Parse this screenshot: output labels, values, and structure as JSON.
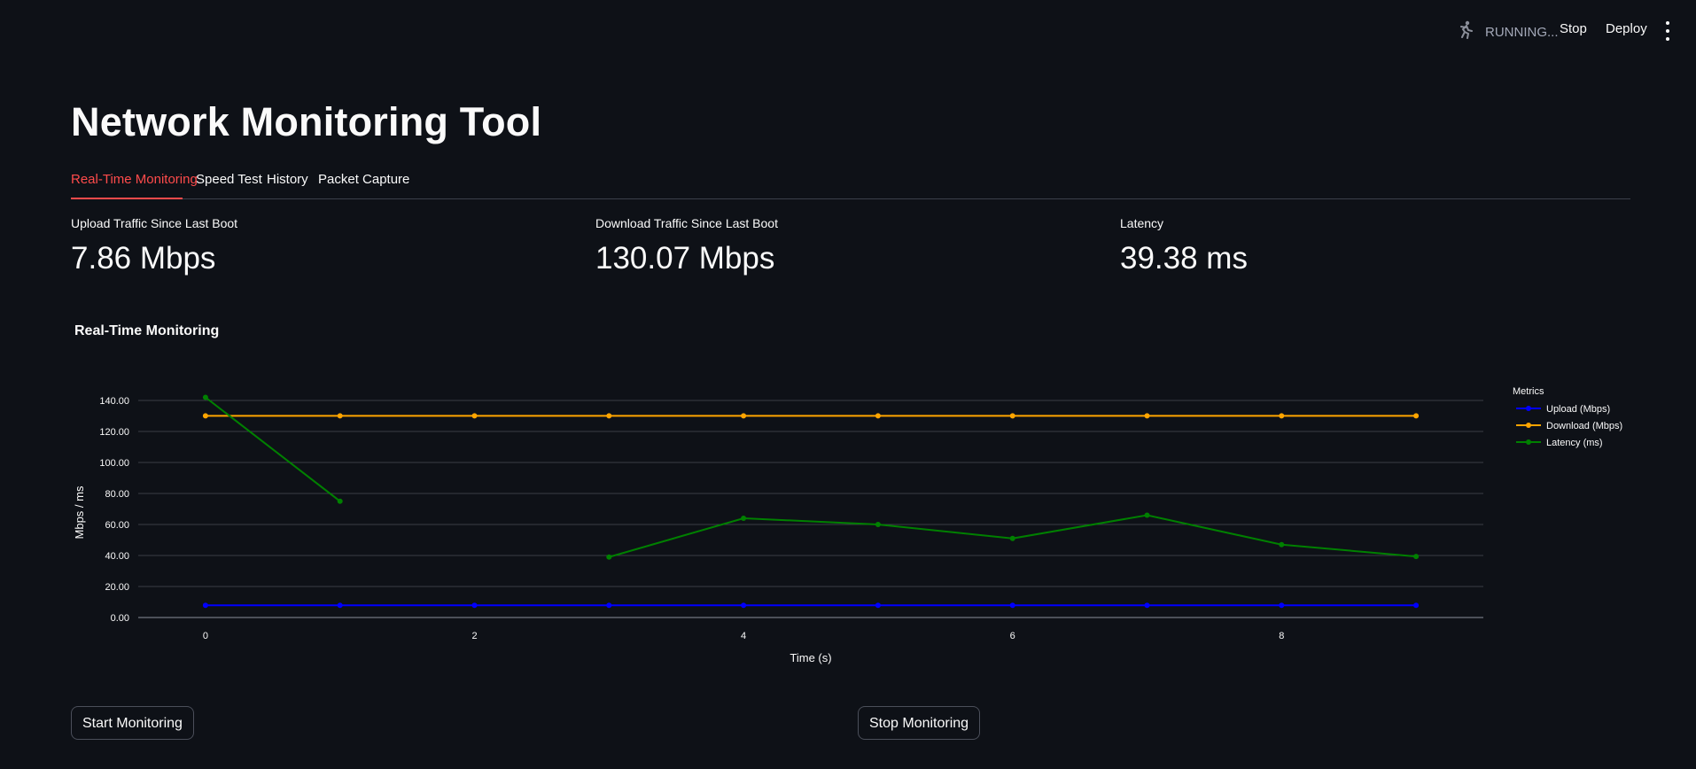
{
  "header": {
    "status_text": "RUNNING...",
    "stop_label": "Stop",
    "deploy_label": "Deploy",
    "menu_icon": "vertical-dots-icon",
    "status_icon": "running-figure-icon"
  },
  "page": {
    "title": "Network Monitoring Tool"
  },
  "tabs": [
    {
      "label": "Real-Time Monitoring",
      "active": true
    },
    {
      "label": "Speed Test",
      "active": false
    },
    {
      "label": "History",
      "active": false
    },
    {
      "label": "Packet Capture",
      "active": false
    }
  ],
  "metrics": [
    {
      "label": "Upload Traffic Since Last Boot",
      "value": "7.86 Mbps"
    },
    {
      "label": "Download Traffic Since Last Boot",
      "value": "130.07 Mbps"
    },
    {
      "label": "Latency",
      "value": "39.38 ms"
    }
  ],
  "buttons": {
    "start_label": "Start Monitoring",
    "stop_label": "Stop Monitoring"
  },
  "colors": {
    "background": "#0e1117",
    "accent": "#ff4b4b",
    "upload": "#0000ff",
    "download": "#ffa500",
    "latency": "#008000"
  },
  "chart_data": {
    "type": "line",
    "title": "Real-Time Monitoring",
    "xlabel": "Time (s)",
    "ylabel": "Mbps / ms",
    "legend_title": "Metrics",
    "legend_position": "right",
    "grid": true,
    "xlim": [
      -0.5,
      9.5
    ],
    "ylim": [
      0,
      140
    ],
    "xticks": [
      0,
      2,
      4,
      6,
      8
    ],
    "yticks": [
      "0.00",
      "20.00",
      "40.00",
      "60.00",
      "80.00",
      "100.00",
      "120.00",
      "140.00"
    ],
    "x": [
      0,
      1,
      2,
      3,
      4,
      5,
      6,
      7,
      8,
      9
    ],
    "series": [
      {
        "name": "Upload (Mbps)",
        "color": "#0000ff",
        "values": [
          7.86,
          7.86,
          7.86,
          7.86,
          7.86,
          7.86,
          7.86,
          7.86,
          7.86,
          7.86
        ]
      },
      {
        "name": "Download (Mbps)",
        "color": "#ffa500",
        "values": [
          130.07,
          130.07,
          130.07,
          130.07,
          130.07,
          130.07,
          130.07,
          130.07,
          130.07,
          130.07
        ]
      },
      {
        "name": "Latency (ms)",
        "color": "#008000",
        "values": [
          142,
          75,
          null,
          39,
          64,
          60,
          51,
          66,
          47,
          39.38
        ]
      }
    ]
  }
}
